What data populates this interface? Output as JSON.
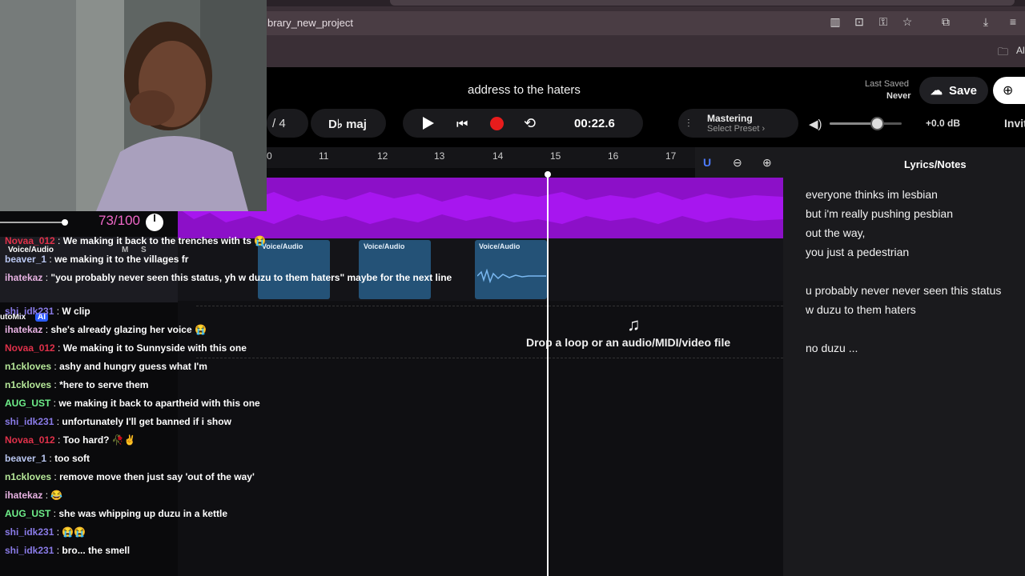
{
  "browser": {
    "url": "brary_new_project",
    "bookmarks_all": "Al"
  },
  "header": {
    "project_title": "address to the haters",
    "last_saved_label": "Last Saved",
    "last_saved_value": "Never",
    "save_label": "Save",
    "invite_label": "Invit"
  },
  "transport": {
    "time_signature": "/ 4",
    "key": "D♭ maj",
    "time": "00:22.6"
  },
  "mastering": {
    "label": "Mastering",
    "preset": "Select Preset ›"
  },
  "volume": {
    "db": "+0.0 dB",
    "level": 0.66
  },
  "ruler": {
    "bars": [
      "0",
      "11",
      "12",
      "13",
      "14",
      "15",
      "16",
      "17"
    ]
  },
  "clips": [
    {
      "label": "Voice/Audio"
    },
    {
      "label": "Voice/Audio"
    },
    {
      "label": "Voice/Audio"
    }
  ],
  "drop_zone": {
    "text": "Drop a loop or an audio/MIDI/video file"
  },
  "lyrics": {
    "title": "Lyrics/Notes",
    "lines": [
      "everyone thinks im lesbian",
      "but i'm really pushing pesbian",
      "out the way,",
      "you just a pedestrian",
      "u probably never never seen this status",
      "w duzu to them haters",
      "no duzu ..."
    ]
  },
  "sidebar_overlay": {
    "track_name": "Voice/Audio",
    "mute": "M",
    "solo": "S",
    "automix": "utoMix",
    "ai": "AI"
  },
  "votes": {
    "text": "73/100"
  },
  "chat": [
    {
      "user": "Novaa_012",
      "color": "#e0314a",
      "msg": "We making it back to the trenches with ts 😭"
    },
    {
      "user": "beaver_1",
      "color": "#b9c6f0",
      "msg": "we making it to the villages fr"
    },
    {
      "user": "ihatekaz",
      "color": "#e7b2e2",
      "msg": "\"you probably never seen this status, yh w duzu to them haters\" maybe for the next line"
    },
    {
      "user": "shi_idk231",
      "color": "#8a7be8",
      "msg": "W clip"
    },
    {
      "user": "ihatekaz",
      "color": "#e7b2e2",
      "msg": "she's already glazing her voice 😭"
    },
    {
      "user": "Novaa_012",
      "color": "#e0314a",
      "msg": "We making it to Sunnyside with this one"
    },
    {
      "user": "n1ckloves",
      "color": "#b7e99a",
      "msg": "ashy and hungry guess what I'm"
    },
    {
      "user": "n1ckloves",
      "color": "#b7e99a",
      "msg": "*here to serve them"
    },
    {
      "user": "AUG_UST",
      "color": "#6ff08a",
      "msg": "we making it back to apartheid with this one"
    },
    {
      "user": "shi_idk231",
      "color": "#8a7be8",
      "msg": "unfortunately I'll get banned if i show"
    },
    {
      "user": "Novaa_012",
      "color": "#e0314a",
      "msg": "Too hard? 🥀✌️"
    },
    {
      "user": "beaver_1",
      "color": "#b9c6f0",
      "msg": "too soft"
    },
    {
      "user": "n1ckloves",
      "color": "#b7e99a",
      "msg": "remove move then just say 'out of the way'"
    },
    {
      "user": "ihatekaz",
      "color": "#e7b2e2",
      "msg": "😂"
    },
    {
      "user": "AUG_UST",
      "color": "#6ff08a",
      "msg": "she was whipping up duzu in a kettle"
    },
    {
      "user": "shi_idk231",
      "color": "#8a7be8",
      "msg": "😭😭"
    },
    {
      "user": "shi_idk231",
      "color": "#8a7be8",
      "msg": "bro... the smell"
    }
  ]
}
